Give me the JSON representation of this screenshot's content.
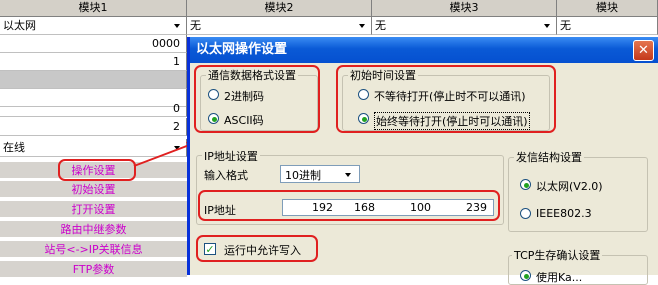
{
  "grid": {
    "headers": [
      "模块1",
      "模块2",
      "模块3",
      "模块"
    ],
    "col1": {
      "row1": "以太网",
      "row2": "0000",
      "row3": "1",
      "row5": "0",
      "row6": "2",
      "row7": "在线"
    },
    "col2_row1": "无",
    "col3_row1": "无",
    "col4_row1": "无",
    "side_buttons": [
      "操作设置",
      "初始设置",
      "打开设置",
      "路由中继参数",
      "站号<->IP关联信息",
      "FTP参数"
    ]
  },
  "dialog": {
    "title": "以太网操作设置",
    "close_glyph": "✕",
    "comm_format": {
      "title": "通信数据格式设置",
      "options": [
        "2进制码",
        "ASCII码"
      ],
      "selected": "ASCII码"
    },
    "init_timing": {
      "title": "初始时间设置",
      "options": [
        "不等待打开(停止时不可以通讯)",
        "始终等待打开(停止时可以通讯)"
      ],
      "selected": "始终等待打开(停止时可以通讯)"
    },
    "ip_settings": {
      "title": "IP地址设置",
      "input_format_label": "输入格式",
      "input_format_value": "10进制",
      "ip_label": "IP地址",
      "ip": [
        "192",
        "168",
        "100",
        "239"
      ]
    },
    "send_frame": {
      "title": "发信结构设置",
      "options": [
        "以太网(V2.0)",
        "IEEE802.3"
      ],
      "selected": "以太网(V2.0)"
    },
    "allow_write": {
      "label": "运行中允许写入",
      "checked": true
    },
    "tcp_keepalive": {
      "title": "TCP生存确认设置",
      "option": "使用Ka..."
    }
  },
  "colors": {
    "title_bar": "#0a5ad6",
    "annotation_red": "#e02020",
    "sidebar_text": "#cc00cc",
    "dialog_bg": "#ece9d8"
  }
}
